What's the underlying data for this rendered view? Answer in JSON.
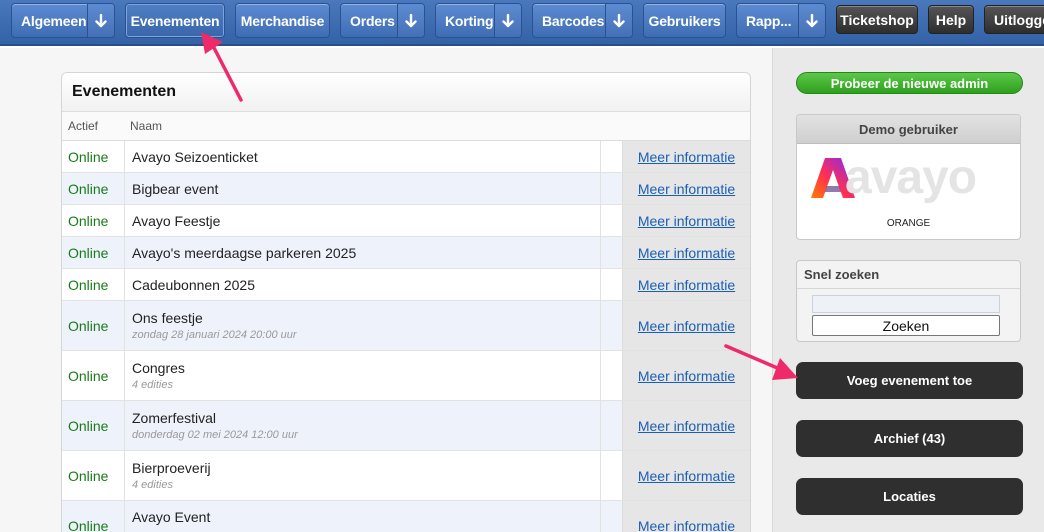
{
  "nav": {
    "items": [
      {
        "label": "Algemeen",
        "has_dropdown": true
      },
      {
        "label": "Evenementen",
        "has_dropdown": false,
        "active": true
      },
      {
        "label": "Merchandise",
        "has_dropdown": false
      },
      {
        "label": "Orders",
        "has_dropdown": true
      },
      {
        "label": "Korting",
        "has_dropdown": true
      },
      {
        "label": "Barcodes",
        "has_dropdown": true
      },
      {
        "label": "Gebruikers",
        "has_dropdown": false
      },
      {
        "label": "Rapp...",
        "has_dropdown": true
      }
    ],
    "right_items": [
      "Ticketshop",
      "Help",
      "Uitloggen"
    ]
  },
  "events_panel": {
    "title": "Evenementen",
    "columns": {
      "status": "Actief",
      "name": "Naam"
    },
    "rows": [
      {
        "status": "Online",
        "name": "Avayo Seizoenticket",
        "sub": "",
        "link": "Meer informatie"
      },
      {
        "status": "Online",
        "name": "Bigbear event",
        "sub": "",
        "link": "Meer informatie"
      },
      {
        "status": "Online",
        "name": "Avayo Feestje",
        "sub": "",
        "link": "Meer informatie"
      },
      {
        "status": "Online",
        "name": "Avayo's meerdaagse parkeren 2025",
        "sub": "",
        "link": "Meer informatie"
      },
      {
        "status": "Online",
        "name": "Cadeubonnen 2025",
        "sub": "",
        "link": "Meer informatie"
      },
      {
        "status": "Online",
        "name": "Ons feestje",
        "sub": "zondag 28 januari 2024 20:00 uur",
        "link": "Meer informatie"
      },
      {
        "status": "Online",
        "name": "Congres",
        "sub": "4 edities",
        "link": "Meer informatie"
      },
      {
        "status": "Online",
        "name": "Zomerfestival",
        "sub": "donderdag 02 mei 2024 12:00 uur",
        "link": "Meer informatie"
      },
      {
        "status": "Online",
        "name": "Bierproeverij",
        "sub": "4 edities",
        "link": "Meer informatie"
      },
      {
        "status": "Online",
        "name": "Avayo Event",
        "sub": "",
        "link": "Meer informatie"
      }
    ]
  },
  "sidebar": {
    "new_admin_label": "Probeer de nieuwe admin",
    "demo_title": "Demo gebruiker",
    "logo_text": "avayo",
    "logo_caption": "ORANGE",
    "search_title": "Snel zoeken",
    "search_value": "",
    "search_button": "Zoeken",
    "add_event": "Voeg evenement toe",
    "archive": "Archief (43)",
    "locations": "Locaties"
  },
  "colors": {
    "nav_blue": "#3f6db4",
    "online_green": "#1a7a1a",
    "link_blue": "#1a5fb4",
    "dark_button": "#2f2f2f",
    "new_admin_green": "#2ea01c",
    "annotation_pink": "#ee2a6b"
  }
}
